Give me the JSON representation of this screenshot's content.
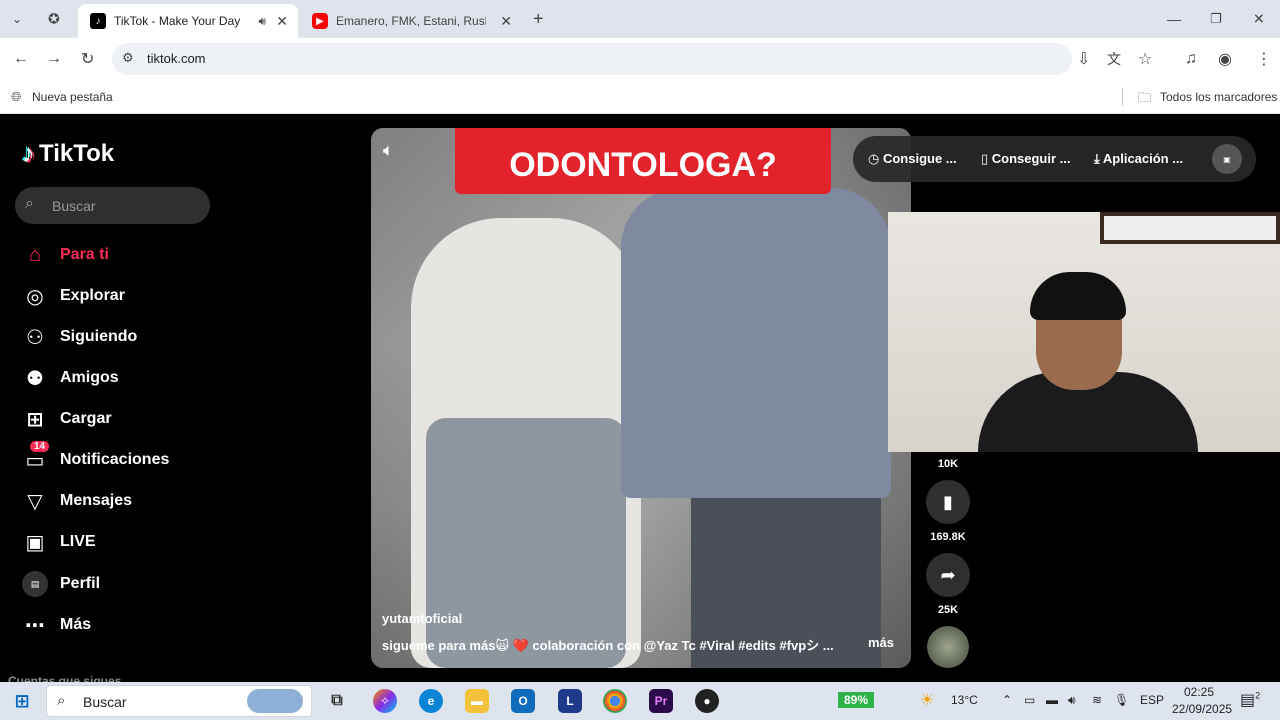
{
  "browser": {
    "tabs": [
      {
        "title": "TikTok - Make Your Day",
        "active": true,
        "favicon": "tiktok-icon"
      },
      {
        "title": "Emanero, FMK, Estani, Rusherk",
        "active": false,
        "favicon": "youtube-icon"
      }
    ],
    "url": "tiktok.com",
    "bookmark_new_tab": "Nueva pestaña",
    "bookmark_all": "Todos los marcadores"
  },
  "tiktok": {
    "logo": "TikTok",
    "search_placeholder": "Buscar",
    "nav": [
      {
        "label": "Para ti",
        "icon": "home-icon",
        "active": true
      },
      {
        "label": "Explorar",
        "icon": "compass-icon"
      },
      {
        "label": "Siguiendo",
        "icon": "following-icon"
      },
      {
        "label": "Amigos",
        "icon": "friends-icon"
      },
      {
        "label": "Cargar",
        "icon": "upload-icon"
      },
      {
        "label": "Notificaciones",
        "icon": "inbox-icon",
        "badge": "14"
      },
      {
        "label": "Mensajes",
        "icon": "send-icon"
      },
      {
        "label": "LIVE",
        "icon": "live-icon"
      },
      {
        "label": "Perfil",
        "icon": "profile-icon"
      },
      {
        "label": "Más",
        "icon": "more-icon"
      }
    ],
    "following_heading": "Cuentas que sigues",
    "video": {
      "banner": "ODONTOLOGA?",
      "author": "yutamtoficial",
      "caption": "sigueme para más🙀 ❤️ colaboración con @Yaz Tc #Viral #edits #fvpシ ...",
      "more": "más"
    },
    "top_pills": [
      "Consigue ...",
      "Conseguir ...",
      "Aplicación ..."
    ],
    "actions": [
      {
        "icon": "like-icon",
        "count": "10K"
      },
      {
        "icon": "bookmark-icon",
        "count": "169.8K"
      },
      {
        "icon": "share-icon",
        "count": "25K"
      }
    ]
  },
  "taskbar": {
    "search_placeholder": "Buscar",
    "battery": "89%",
    "temperature": "13°C",
    "language": "ESP",
    "time": "02:25",
    "date": "22/09/2025",
    "notif_count": "2"
  }
}
